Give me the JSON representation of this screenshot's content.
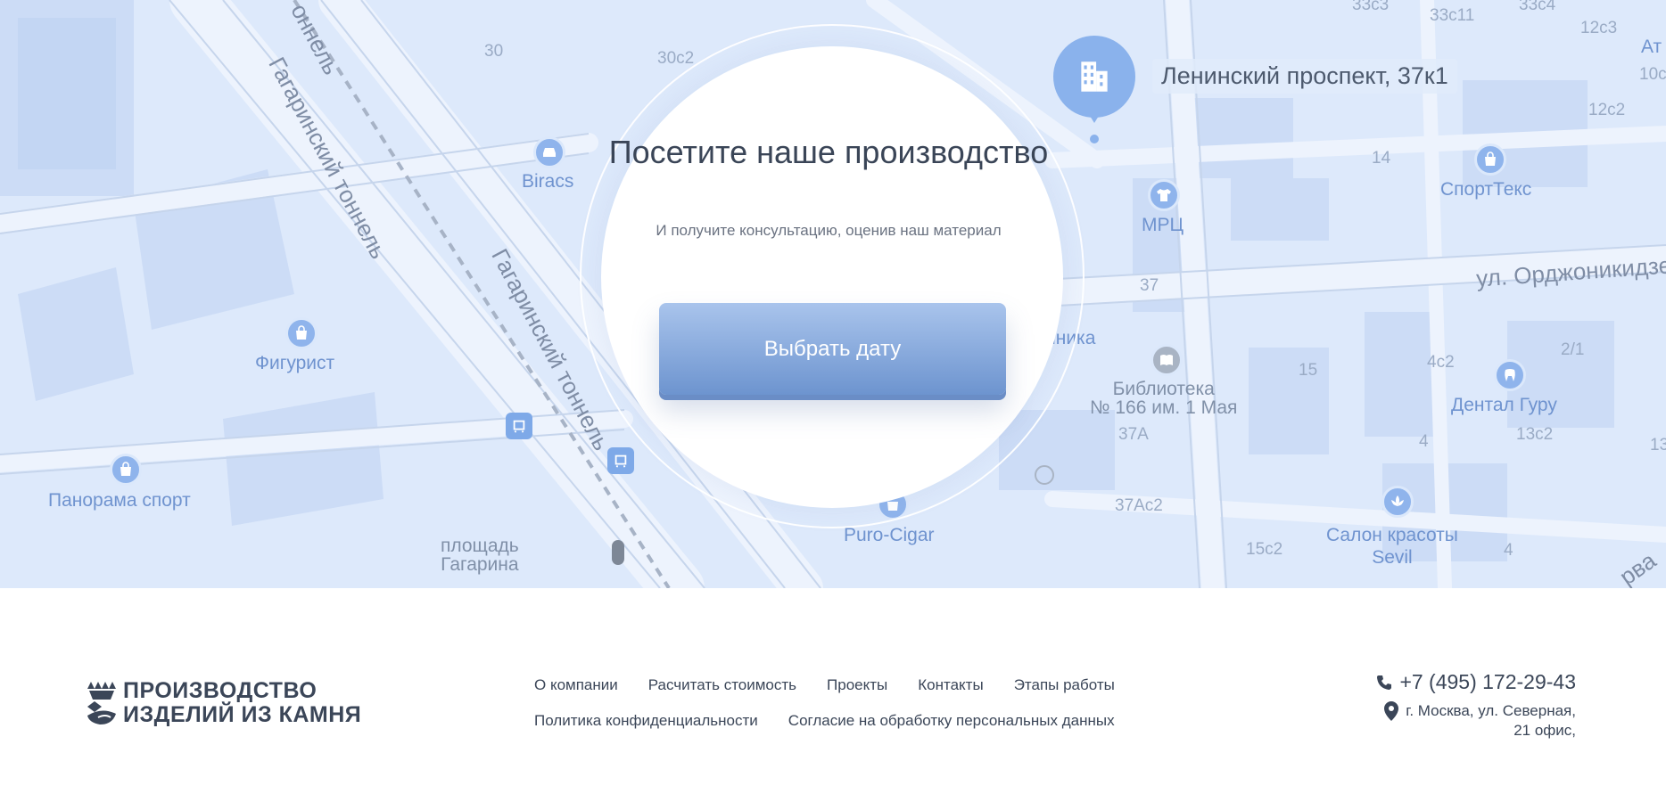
{
  "map": {
    "labels": {
      "street_gagarin_1": "Гагаринский тоннель",
      "street_gagarin_2": "Гагаринский тоннель",
      "street_gagarin_3": "Гагаринский тоннель",
      "street_tunnel_top": "оннель",
      "street_ordzho": "ул. Орджоникидзе",
      "n30": "30",
      "n30c2": "30с2",
      "n33c3": "33с3",
      "n33c11": "33с11",
      "n33c4": "33с4",
      "n12c3": "12с3",
      "n12c2": "12с2",
      "n10c": "10с",
      "n14": "14",
      "n37": "37",
      "n37a": "37А",
      "n37ac2": "37Ас2",
      "n15": "15",
      "n4c2": "4с2",
      "n2_1": "2/1",
      "n13c2": "13с2",
      "n4a": "4",
      "n4b": "4",
      "n15c2": "15с2",
      "n13": "13",
      "at": "Ат",
      "rva": "рва",
      "ploshad": "площадь\nГагарина"
    },
    "pois": {
      "biracs": "Biracs",
      "figurist": "Фигурист",
      "panorama": "Панорама спорт",
      "mrc": "МРЦ",
      "sporttex": "СпортТекс",
      "clinic": "иника",
      "library": "Библиотека\n№ 166 им. 1 Мая",
      "dental": "Дентал Гуру",
      "salon": "Салон красоты\nSevil",
      "cigar": "Puro-Cigar"
    },
    "marker_label": "Ленинский проспект, 37к1"
  },
  "cta": {
    "title": "Посетите наше производство",
    "subtitle": "И получите консультацию, оценив наш материал",
    "button": "Выбрать дату"
  },
  "footer": {
    "logo_line1": "ПРОИЗВОДСТВО",
    "logo_line2": "ИЗДЕЛИЙ ИЗ КАМНЯ",
    "nav_row1": [
      "О компании",
      "Расчитать стоимость",
      "Проекты",
      "Контакты",
      "Этапы работы"
    ],
    "nav_row2": [
      "Политика конфиденциальности",
      "Согласие на обработку персональных данных"
    ],
    "phone": "+7 (495) 172-29-43",
    "address_line1": "г. Москва, ул. Северная,",
    "address_line2": "21 офис,"
  },
  "colors": {
    "accent": "#6d94cf",
    "map_bg": "#dde9fb",
    "text": "#3b4658"
  }
}
